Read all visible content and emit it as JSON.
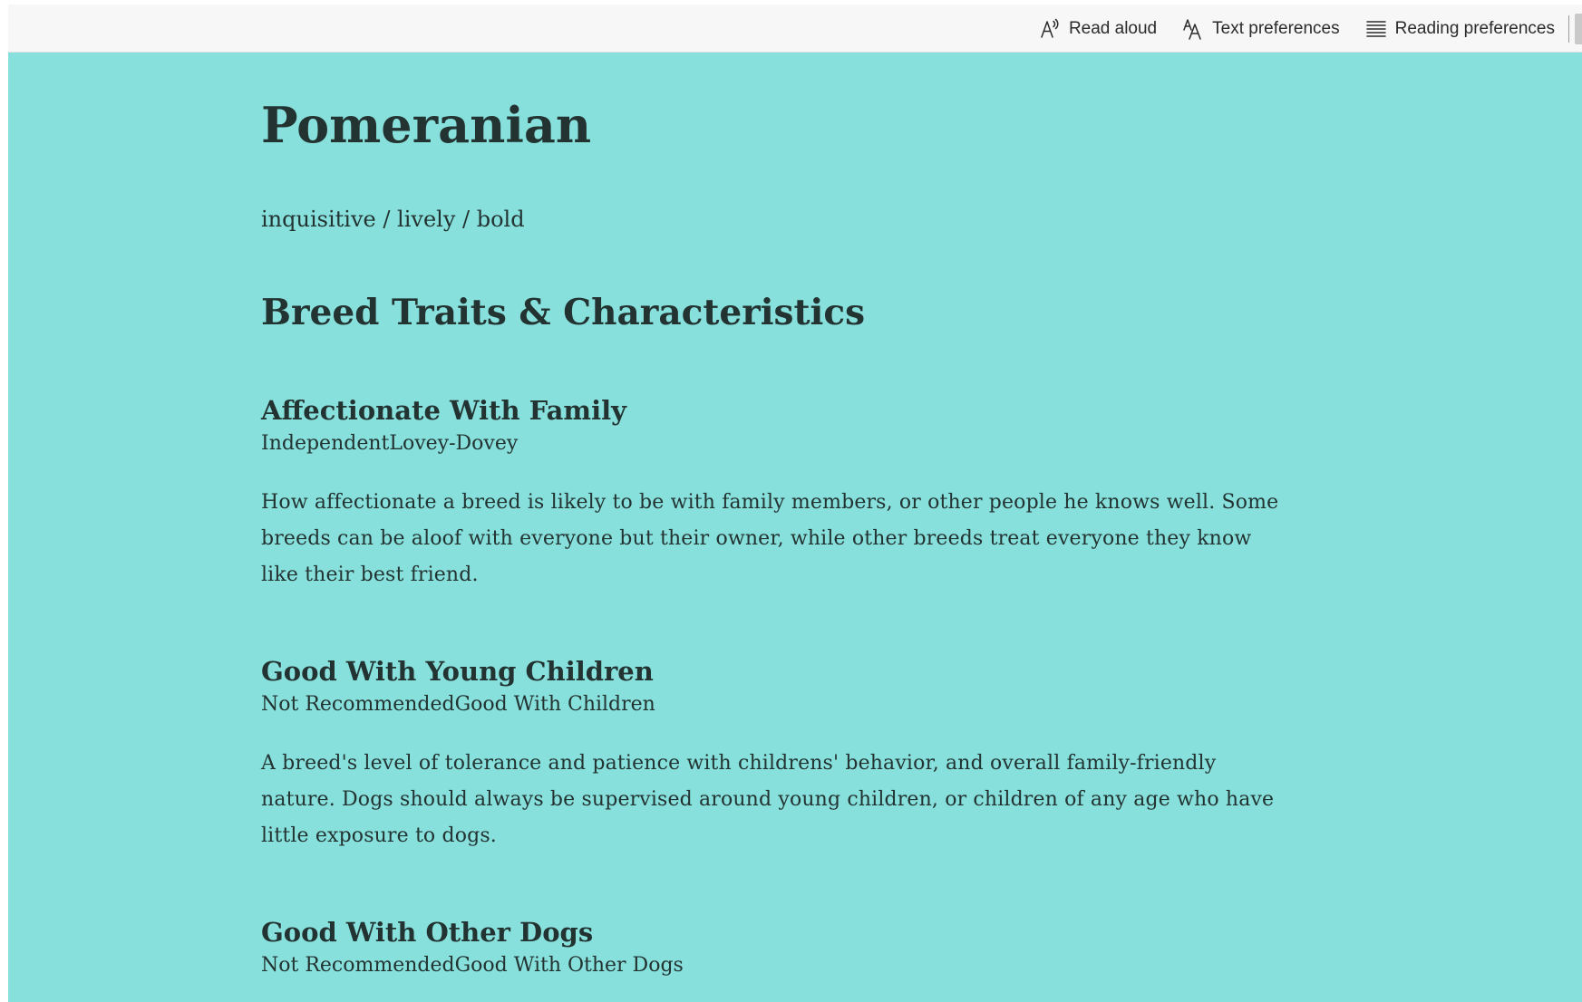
{
  "toolbar": {
    "read_aloud": "Read aloud",
    "text_preferences": "Text preferences",
    "reading_preferences": "Reading preferences"
  },
  "article": {
    "title": "Pomeranian",
    "tagline": "inquisitive / lively / bold",
    "section_title": "Breed Traits & Characteristics",
    "traits": [
      {
        "name": "Affectionate With Family",
        "scale": "IndependentLovey-Dovey",
        "description": "How affectionate a breed is likely to be with family members, or other people he knows well. Some breeds can be aloof with everyone but their owner, while other breeds treat everyone they know like their best friend."
      },
      {
        "name": "Good With Young Children",
        "scale": "Not RecommendedGood With Children",
        "description": "A breed's level of tolerance and patience with childrens' behavior, and overall family-friendly nature. Dogs should always be supervised around young children, or children of any age who have little exposure to dogs."
      },
      {
        "name": "Good With Other Dogs",
        "scale": "Not RecommendedGood With Other Dogs",
        "description": ""
      }
    ]
  },
  "colors": {
    "page_background": "#87e0dc",
    "text": "#233332",
    "toolbar_background": "#f7f7f7"
  },
  "icons": {
    "read_aloud": "read-aloud-icon",
    "text_preferences": "text-preferences-icon",
    "reading_preferences": "reading-preferences-icon"
  }
}
